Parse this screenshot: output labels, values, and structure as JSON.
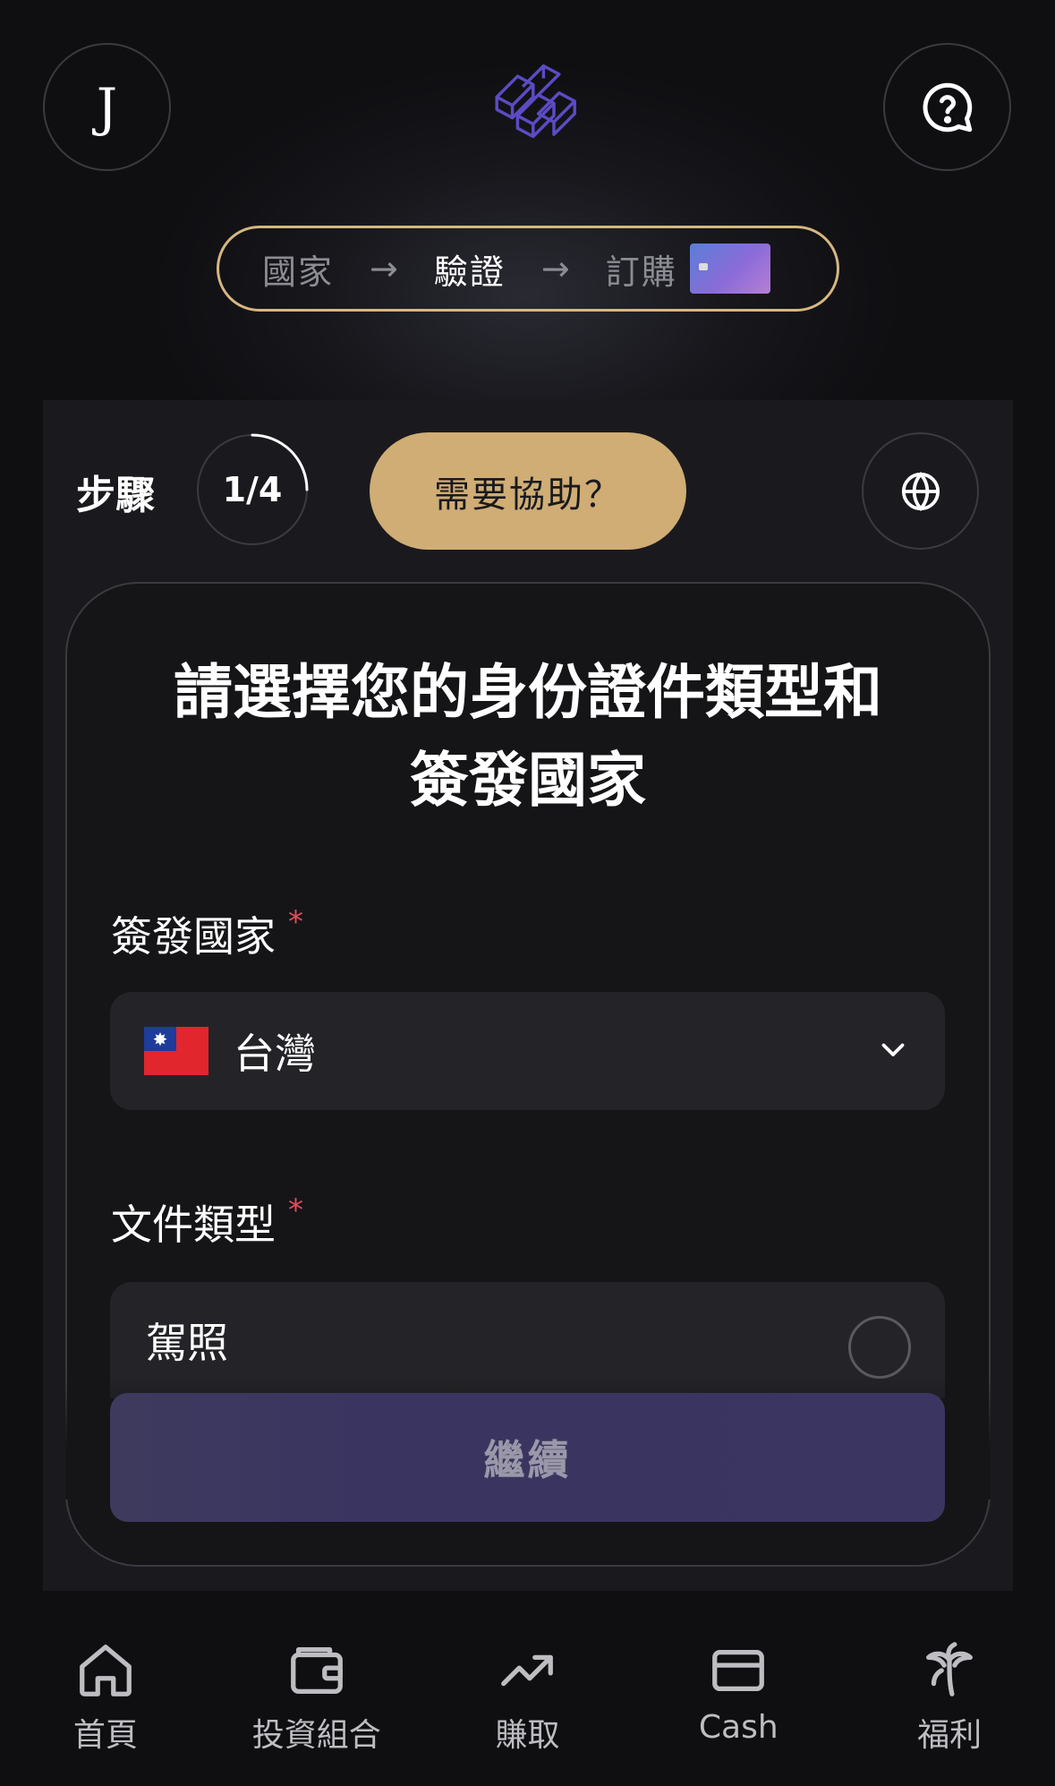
{
  "header": {
    "avatar_initial": "J",
    "steps": [
      "國家",
      "驗證",
      "訂購"
    ],
    "active_step": 1
  },
  "toolbar": {
    "steps_label": "步驟",
    "step_counter": "1/4",
    "step_progress": 0.25,
    "need_help_label": "需要協助？"
  },
  "form": {
    "title_line1": "請選擇您的身份證件類型和",
    "title_line2": "簽發國家",
    "country_label": "簽發國家",
    "country_value": "台灣",
    "doc_type_label": "文件類型",
    "doc_options": [
      "駕照"
    ],
    "required_mark": "*",
    "continue_label": "繼續"
  },
  "bottom_nav": {
    "items": [
      {
        "label": "首頁",
        "icon": "home-icon"
      },
      {
        "label": "投資組合",
        "icon": "wallet-icon"
      },
      {
        "label": "賺取",
        "icon": "trending-up-icon"
      },
      {
        "label": "Cash",
        "icon": "card-icon"
      },
      {
        "label": "福利",
        "icon": "palm-tree-icon"
      }
    ]
  },
  "colors": {
    "accent_gold": "#cfad75",
    "progress_border": "#d6b77f",
    "continue_bg": "#3b3561",
    "required": "#e24d5a"
  }
}
